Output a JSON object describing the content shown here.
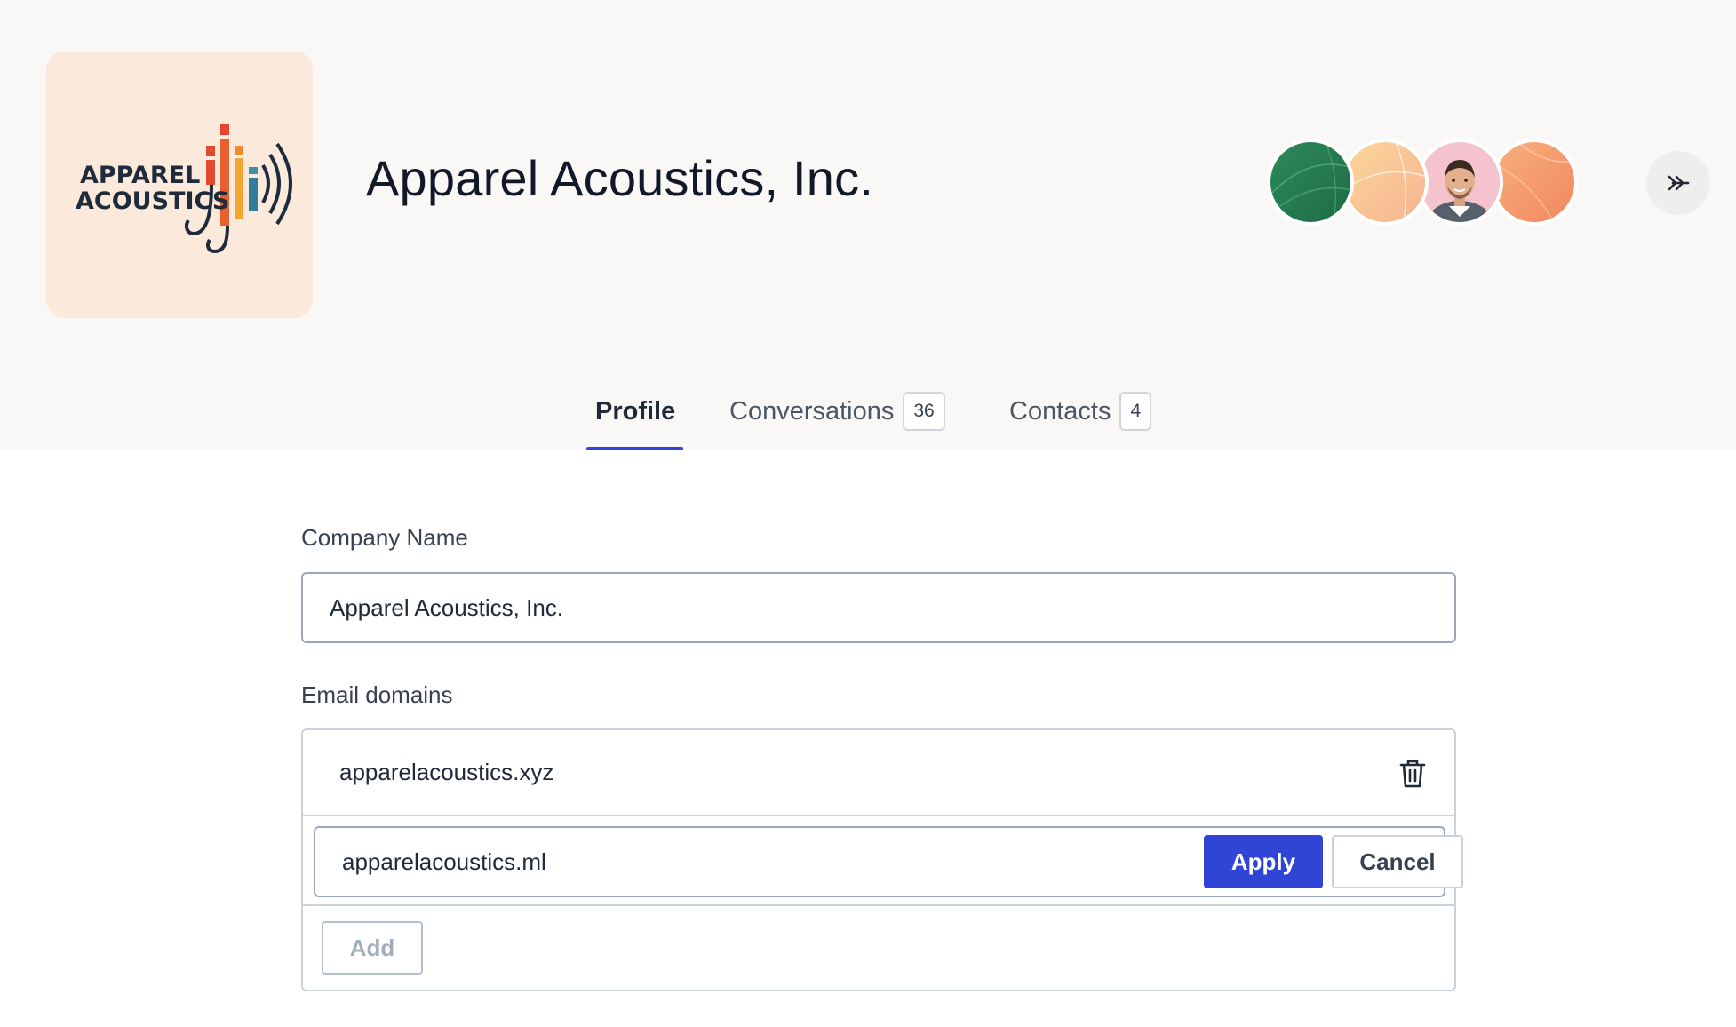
{
  "header": {
    "logo_text_line1": "APPAREL",
    "logo_text_line2": "ACOUSTICS",
    "company_title": "Apparel Acoustics, Inc.",
    "collapse_icon": "double-chevron-right-icon"
  },
  "avatars": [
    {
      "kind": "pattern",
      "color": "#2e7d4f"
    },
    {
      "kind": "pattern",
      "color": "#f7c98f"
    },
    {
      "kind": "photo",
      "color": "#f3c1cc"
    },
    {
      "kind": "pattern",
      "color": "#f39a6c"
    }
  ],
  "tabs": [
    {
      "label": "Profile",
      "active": true
    },
    {
      "label": "Conversations",
      "count": "36",
      "active": false
    },
    {
      "label": "Contacts",
      "count": "4",
      "active": false
    }
  ],
  "form": {
    "company_name_label": "Company Name",
    "company_name_value": "Apparel Acoustics, Inc.",
    "email_domains_label": "Email domains",
    "domains": [
      "apparelacoustics.xyz"
    ],
    "editing_domain_value": "apparelacoustics.ml",
    "apply_label": "Apply",
    "cancel_label": "Cancel",
    "add_label": "Add"
  },
  "colors": {
    "accent": "#3045d6",
    "header_bg": "#f9f8f7",
    "logo_bg": "#fbeadb"
  }
}
